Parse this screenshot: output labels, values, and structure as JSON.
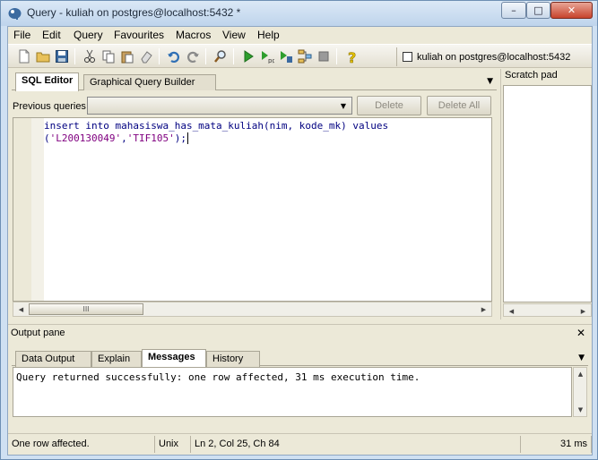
{
  "window": {
    "title": "Query - kuliah on postgres@localhost:5432 *",
    "min_label": "–",
    "max_label": "□",
    "close_label": "✕"
  },
  "menu": {
    "items": [
      {
        "label": "File"
      },
      {
        "label": "Edit"
      },
      {
        "label": "Query"
      },
      {
        "label": "Favourites"
      },
      {
        "label": "Macros"
      },
      {
        "label": "View"
      },
      {
        "label": "Help"
      }
    ]
  },
  "toolbar": {
    "connection_label": "kuliah on postgres@localhost:5432",
    "icons": [
      "new-file-icon",
      "open-folder-icon",
      "save-icon",
      "cut-icon",
      "copy-icon",
      "paste-icon",
      "clear-icon",
      "undo-icon",
      "redo-icon",
      "find-icon",
      "execute-icon",
      "execute-pgscript-icon",
      "execute-to-file-icon",
      "explain-icon",
      "cancel-icon",
      "help-icon"
    ],
    "colors": {
      "execute": "#2e9e2e",
      "help": "#e6c200",
      "undo": "#2f6fb5"
    }
  },
  "editor": {
    "tabs": [
      {
        "label": "SQL Editor",
        "active": true
      },
      {
        "label": "Graphical Query Builder",
        "active": false
      }
    ],
    "previous_queries_label": "Previous queries",
    "delete_label": "Delete",
    "delete_all_label": "Delete All",
    "code_line1_kw": "insert into mahasiswa_has_mata_kuliah(nim, kode_mk) values",
    "code_line2_open": "(",
    "code_line2_str1": "'L200130049'",
    "code_line2_comma": ",",
    "code_line2_str2": "'TIF105'",
    "code_line2_close": ");",
    "hscroll_thumb_label": "III"
  },
  "scratch_pad": {
    "title": "Scratch pad"
  },
  "output": {
    "title": "Output pane",
    "close_label": "✕",
    "tabs": [
      {
        "label": "Data Output",
        "active": false
      },
      {
        "label": "Explain",
        "active": false
      },
      {
        "label": "Messages",
        "active": true
      },
      {
        "label": "History",
        "active": false
      }
    ],
    "message": "Query returned successfully: one row affected, 31 ms execution time."
  },
  "status": {
    "message": "One row affected.",
    "line_ending": "Unix",
    "position": "Ln 2, Col 25, Ch 84",
    "time": "31 ms"
  }
}
